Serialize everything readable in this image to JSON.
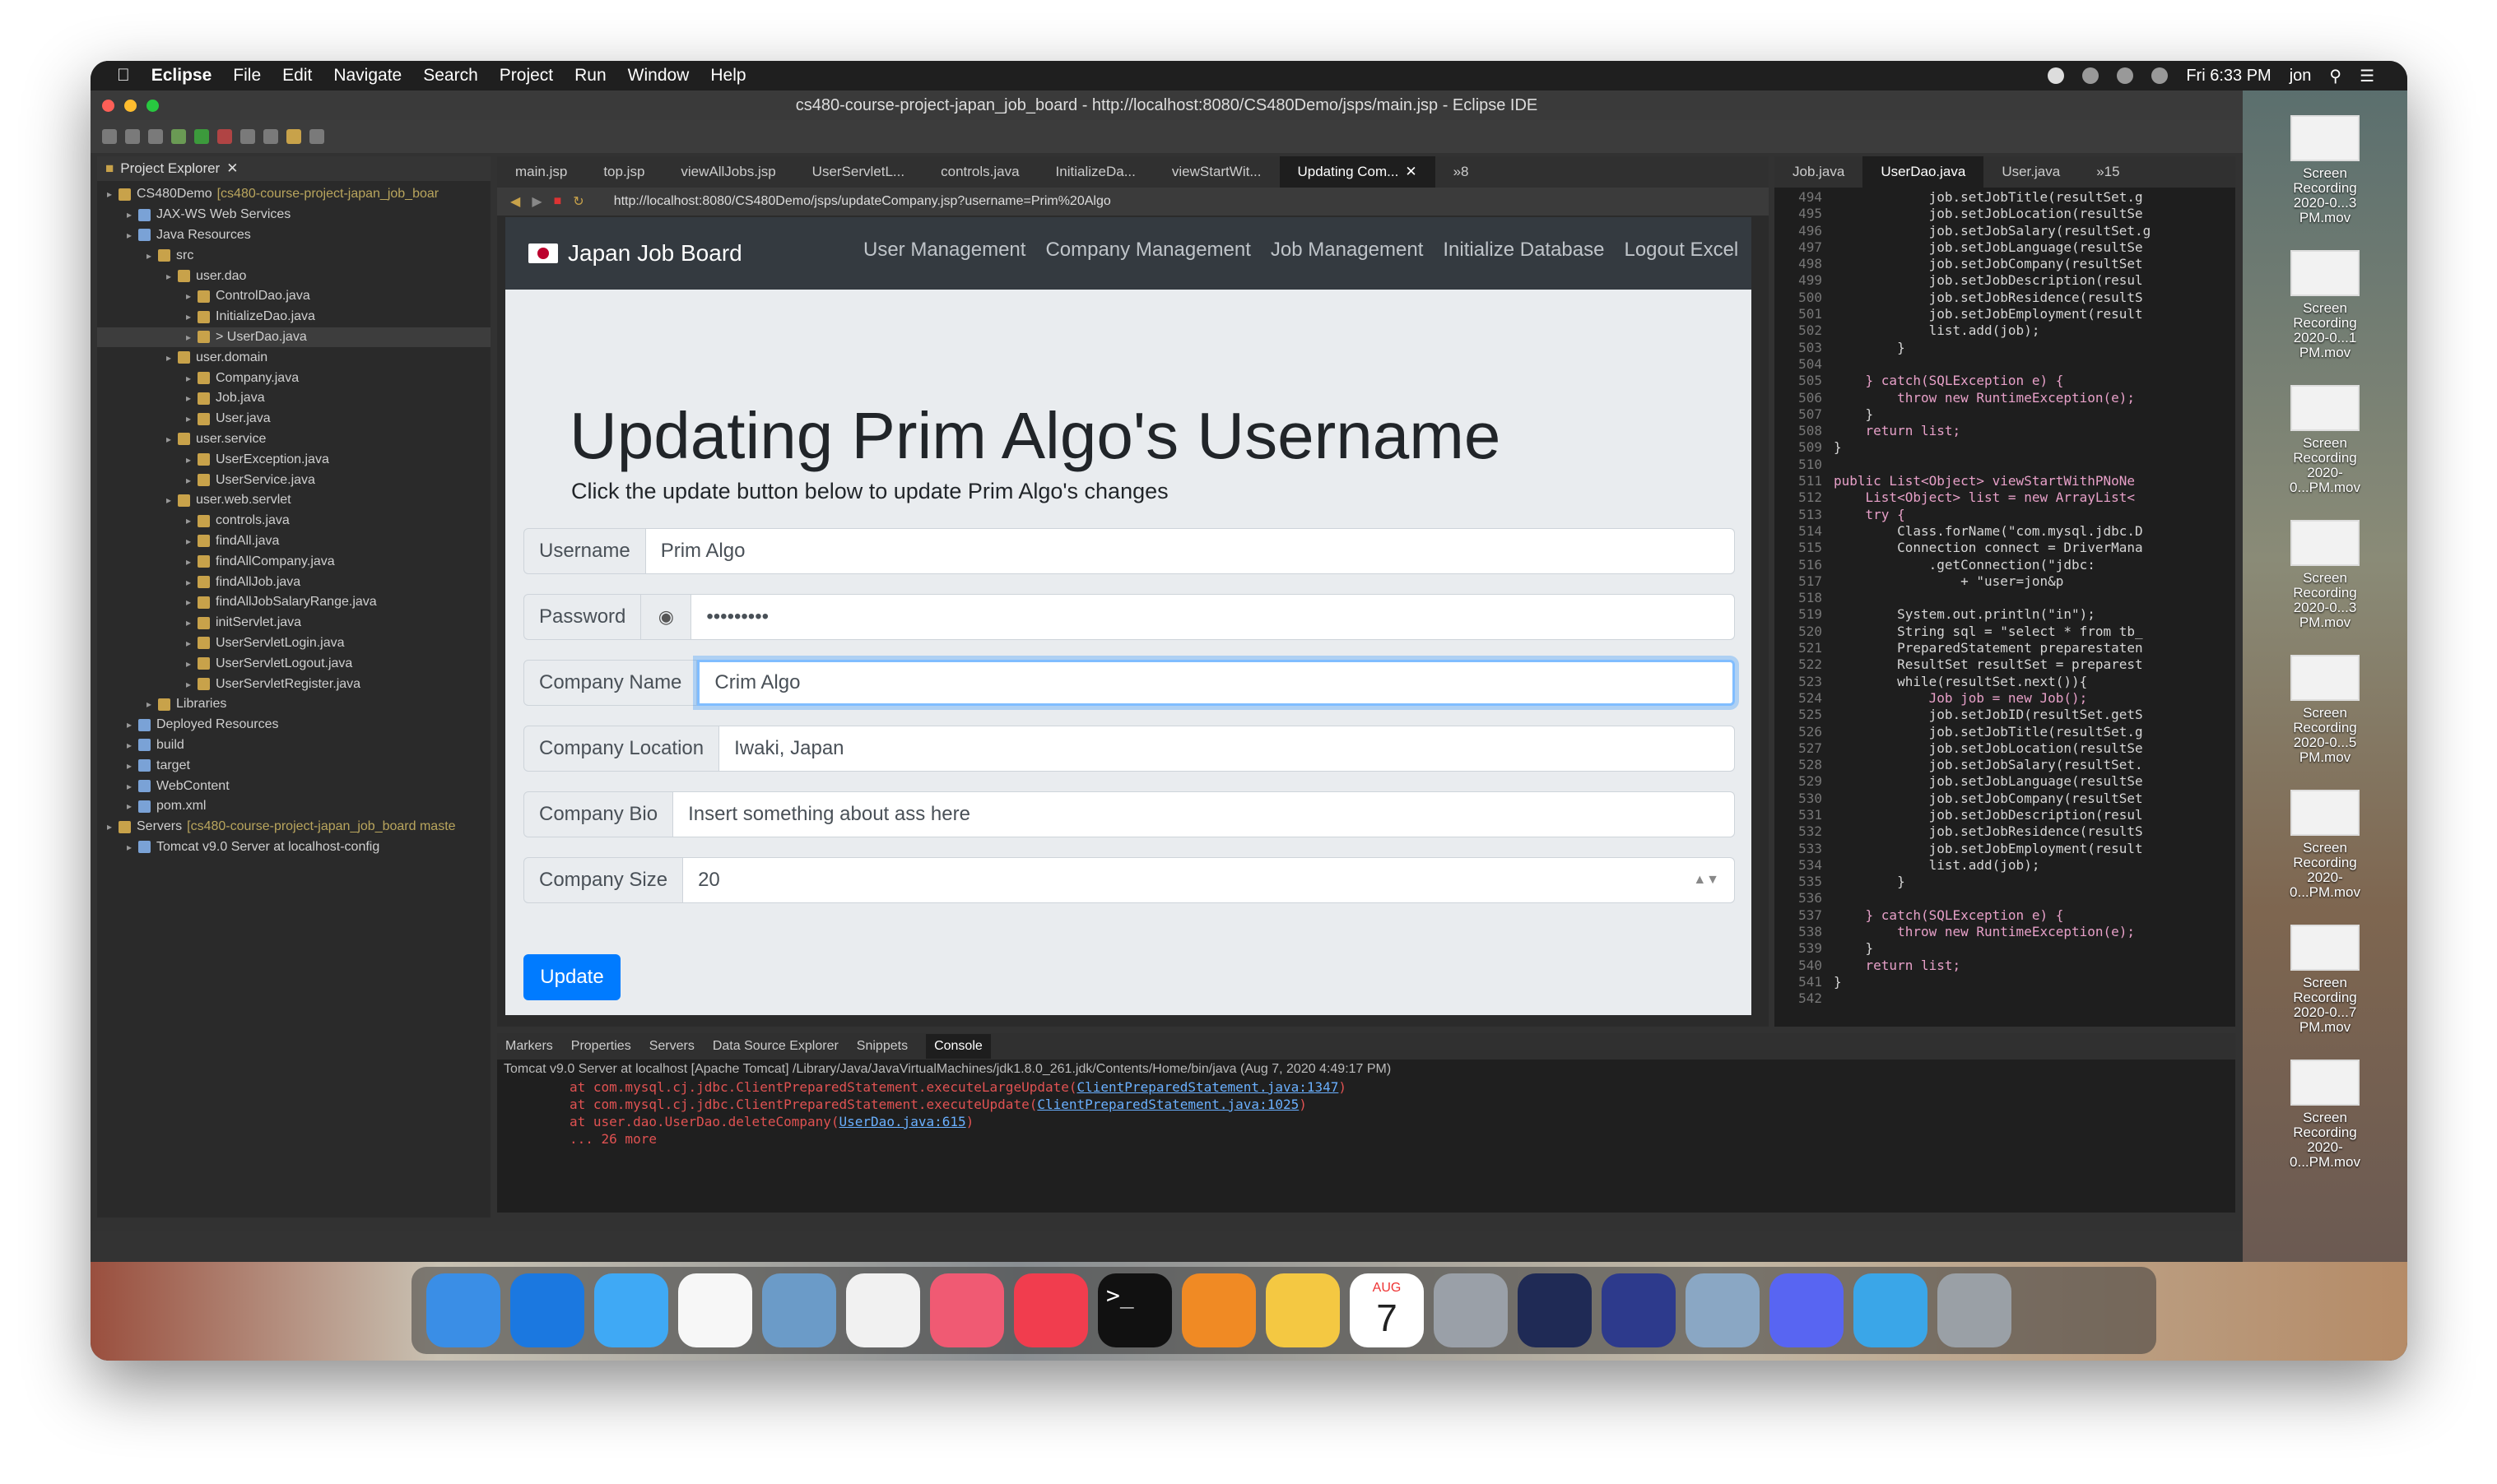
{
  "menubar": {
    "app": "Eclipse",
    "items": [
      "File",
      "Edit",
      "Navigate",
      "Search",
      "Project",
      "Run",
      "Window",
      "Help"
    ],
    "clock": "Fri 6:33 PM",
    "user": "jon"
  },
  "window": {
    "title": "cs480-course-project-japan_job_board - http://localhost:8080/CS480Demo/jsps/main.jsp - Eclipse IDE"
  },
  "explorer": {
    "tab_label": "Project Explorer",
    "items": [
      {
        "label": "CS480Demo",
        "extra": "[cs480-course-project-japan_job_boar",
        "depth": 0
      },
      {
        "label": "JAX-WS Web Services",
        "extra": "",
        "depth": 1
      },
      {
        "label": "Java Resources",
        "extra": "",
        "depth": 1
      },
      {
        "label": "src",
        "extra": "",
        "depth": 2
      },
      {
        "label": "user.dao",
        "extra": "",
        "depth": 3
      },
      {
        "label": "ControlDao.java",
        "extra": "",
        "depth": 4
      },
      {
        "label": "InitializeDao.java",
        "extra": "",
        "depth": 4
      },
      {
        "label": "> UserDao.java",
        "extra": "",
        "depth": 4
      },
      {
        "label": "user.domain",
        "extra": "",
        "depth": 3
      },
      {
        "label": "Company.java",
        "extra": "",
        "depth": 4
      },
      {
        "label": "Job.java",
        "extra": "",
        "depth": 4
      },
      {
        "label": "User.java",
        "extra": "",
        "depth": 4
      },
      {
        "label": "user.service",
        "extra": "",
        "depth": 3
      },
      {
        "label": "UserException.java",
        "extra": "",
        "depth": 4
      },
      {
        "label": "UserService.java",
        "extra": "",
        "depth": 4
      },
      {
        "label": "user.web.servlet",
        "extra": "",
        "depth": 3
      },
      {
        "label": "controls.java",
        "extra": "",
        "depth": 4
      },
      {
        "label": "findAll.java",
        "extra": "",
        "depth": 4
      },
      {
        "label": "findAllCompany.java",
        "extra": "",
        "depth": 4
      },
      {
        "label": "findAllJob.java",
        "extra": "",
        "depth": 4
      },
      {
        "label": "findAllJobSalaryRange.java",
        "extra": "",
        "depth": 4
      },
      {
        "label": "initServlet.java",
        "extra": "",
        "depth": 4
      },
      {
        "label": "UserServletLogin.java",
        "extra": "",
        "depth": 4
      },
      {
        "label": "UserServletLogout.java",
        "extra": "",
        "depth": 4
      },
      {
        "label": "UserServletRegister.java",
        "extra": "",
        "depth": 4
      },
      {
        "label": "Libraries",
        "extra": "",
        "depth": 2
      },
      {
        "label": "Deployed Resources",
        "extra": "",
        "depth": 1
      },
      {
        "label": "build",
        "extra": "",
        "depth": 1
      },
      {
        "label": "target",
        "extra": "",
        "depth": 1
      },
      {
        "label": "WebContent",
        "extra": "",
        "depth": 1
      },
      {
        "label": "pom.xml",
        "extra": "",
        "depth": 1
      },
      {
        "label": "Servers",
        "extra": "[cs480-course-project-japan_job_board maste",
        "depth": 0
      },
      {
        "label": "Tomcat v9.0 Server at localhost-config",
        "extra": "",
        "depth": 1
      }
    ]
  },
  "editor": {
    "tabs": [
      "main.jsp",
      "top.jsp",
      "viewAllJobs.jsp",
      "UserServletL...",
      "controls.java",
      "InitializeDa...",
      "viewStartWit...",
      "Updating Com..."
    ],
    "overflow": "»8",
    "url": "http://localhost:8080/CS480Demo/jsps/updateCompany.jsp?username=Prim%20Algo"
  },
  "webpage": {
    "brand": "Japan Job Board",
    "nav": [
      "User Management",
      "Company Management",
      "Job Management",
      "Initialize Database",
      "Logout Excel"
    ],
    "heading": "Updating Prim Algo's Username",
    "lead": "Click the update button below to update Prim Algo's changes",
    "fields": {
      "username_label": "Username",
      "username_value": "Prim Algo",
      "password_label": "Password",
      "password_value": "•••••••••",
      "company_name_label": "Company Name",
      "company_name_value": "Crim Algo",
      "company_location_label": "Company Location",
      "company_location_value": "Iwaki, Japan",
      "company_bio_label": "Company Bio",
      "company_bio_value": "Insert something about ass here",
      "company_size_label": "Company Size",
      "company_size_value": "20"
    },
    "update_button": "Update"
  },
  "code": {
    "tabs": [
      "Job.java",
      "UserDao.java",
      "User.java"
    ],
    "overflow": "»15",
    "lines": [
      {
        "n": "494",
        "t": "            job.setJobTitle(resultSet.g"
      },
      {
        "n": "495",
        "t": "            job.setJobLocation(resultSe"
      },
      {
        "n": "496",
        "t": "            job.setJobSalary(resultSet.g"
      },
      {
        "n": "497",
        "t": "            job.setJobLanguage(resultSe"
      },
      {
        "n": "498",
        "t": "            job.setJobCompany(resultSet"
      },
      {
        "n": "499",
        "t": "            job.setJobDescription(resul"
      },
      {
        "n": "500",
        "t": "            job.setJobResidence(resultS"
      },
      {
        "n": "501",
        "t": "            job.setJobEmployment(result"
      },
      {
        "n": "502",
        "t": "            list.add(job);"
      },
      {
        "n": "503",
        "t": "        }"
      },
      {
        "n": "504",
        "t": ""
      },
      {
        "n": "505",
        "t": "    } catch(SQLException e) {"
      },
      {
        "n": "506",
        "t": "        throw new RuntimeException(e);"
      },
      {
        "n": "507",
        "t": "    }"
      },
      {
        "n": "508",
        "t": "    return list;"
      },
      {
        "n": "509",
        "t": "}"
      },
      {
        "n": "510",
        "t": ""
      },
      {
        "n": "511",
        "t": "public List<Object> viewStartWithPNoNe"
      },
      {
        "n": "512",
        "t": "    List<Object> list = new ArrayList<"
      },
      {
        "n": "513",
        "t": "    try {"
      },
      {
        "n": "514",
        "t": "        Class.forName(\"com.mysql.jdbc.D"
      },
      {
        "n": "515",
        "t": "        Connection connect = DriverMana"
      },
      {
        "n": "516",
        "t": "            .getConnection(\"jdbc:"
      },
      {
        "n": "517",
        "t": "                + \"user=jon&p"
      },
      {
        "n": "518",
        "t": ""
      },
      {
        "n": "519",
        "t": "        System.out.println(\"in\");"
      },
      {
        "n": "520",
        "t": "        String sql = \"select * from tb_"
      },
      {
        "n": "521",
        "t": "        PreparedStatement preparestaten"
      },
      {
        "n": "522",
        "t": "        ResultSet resultSet = preparest"
      },
      {
        "n": "523",
        "t": "        while(resultSet.next()){"
      },
      {
        "n": "524",
        "t": "            Job job = new Job();"
      },
      {
        "n": "525",
        "t": "            job.setJobID(resultSet.getS"
      },
      {
        "n": "526",
        "t": "            job.setJobTitle(resultSet.g"
      },
      {
        "n": "527",
        "t": "            job.setJobLocation(resultSe"
      },
      {
        "n": "528",
        "t": "            job.setJobSalary(resultSet."
      },
      {
        "n": "529",
        "t": "            job.setJobLanguage(resultSe"
      },
      {
        "n": "530",
        "t": "            job.setJobCompany(resultSet"
      },
      {
        "n": "531",
        "t": "            job.setJobDescription(resul"
      },
      {
        "n": "532",
        "t": "            job.setJobResidence(resultS"
      },
      {
        "n": "533",
        "t": "            job.setJobEmployment(result"
      },
      {
        "n": "534",
        "t": "            list.add(job);"
      },
      {
        "n": "535",
        "t": "        }"
      },
      {
        "n": "536",
        "t": ""
      },
      {
        "n": "537",
        "t": "    } catch(SQLException e) {"
      },
      {
        "n": "538",
        "t": "        throw new RuntimeException(e);"
      },
      {
        "n": "539",
        "t": "    }"
      },
      {
        "n": "540",
        "t": "    return list;"
      },
      {
        "n": "541",
        "t": "}"
      },
      {
        "n": "542",
        "t": ""
      }
    ]
  },
  "console": {
    "tabs": [
      "Markers",
      "Properties",
      "Servers",
      "Data Source Explorer",
      "Snippets",
      "Console"
    ],
    "header": "Tomcat v9.0 Server at localhost [Apache Tomcat] /Library/Java/JavaVirtualMachines/jdk1.8.0_261.jdk/Contents/Home/bin/java  (Aug 7, 2020 4:49:17 PM)",
    "lines": [
      {
        "pre": "at com.mysql.cj.jdbc.ClientPreparedStatement.executeLargeUpdate(",
        "link": "ClientPreparedStatement.java:1347",
        "post": ")"
      },
      {
        "pre": "at com.mysql.cj.jdbc.ClientPreparedStatement.executeUpdate(",
        "link": "ClientPreparedStatement.java:1025",
        "post": ")"
      },
      {
        "pre": "at user.dao.UserDao.deleteCompany(",
        "link": "UserDao.java:615",
        "post": ")"
      },
      {
        "pre": "... 26 more",
        "link": "",
        "post": ""
      }
    ]
  },
  "recordings": [
    {
      "line1": "Screen Recording",
      "line2": "2020-0...3 PM.mov"
    },
    {
      "line1": "Screen Recording",
      "line2": "2020-0...1 PM.mov"
    },
    {
      "line1": "Screen Recording",
      "line2": "2020-0...PM.mov"
    },
    {
      "line1": "Screen Recording",
      "line2": "2020-0...3 PM.mov"
    },
    {
      "line1": "Screen Recording",
      "line2": "2020-0...5 PM.mov"
    },
    {
      "line1": "Screen Recording",
      "line2": "2020-0...PM.mov"
    },
    {
      "line1": "Screen Recording",
      "line2": "2020-0...7 PM.mov"
    },
    {
      "line1": "Screen Recording",
      "line2": "2020-0...PM.mov"
    }
  ],
  "dock": {
    "apps": [
      "finder-icon",
      "safari-icon",
      "messages-icon",
      "reminders-icon",
      "preview-icon",
      "textedit-icon",
      "music-icon",
      "news-icon",
      "terminal-icon",
      "books-icon",
      "photos-icon",
      "calendar-icon",
      "launchpad-icon",
      "quicktime-icon",
      "eclipse-icon",
      "image-capture-icon",
      "discord-icon",
      "downloads-folder-icon",
      "trash-icon"
    ],
    "calendar_month": "AUG",
    "calendar_day": "7",
    "colors": [
      "#3a8ee6",
      "#1b78e0",
      "#3fa9f5",
      "#f7f7f7",
      "#6b9bc8",
      "#f1f1f1",
      "#f05a73",
      "#f13d4e",
      "#111111",
      "#f08a24",
      "#f4c842",
      "#ffffff",
      "#9aa0a8",
      "#1f2a55",
      "#2d3a8c",
      "#8aa7c4",
      "#5865f2",
      "#3aa6e8",
      "#9aa0a6"
    ]
  }
}
